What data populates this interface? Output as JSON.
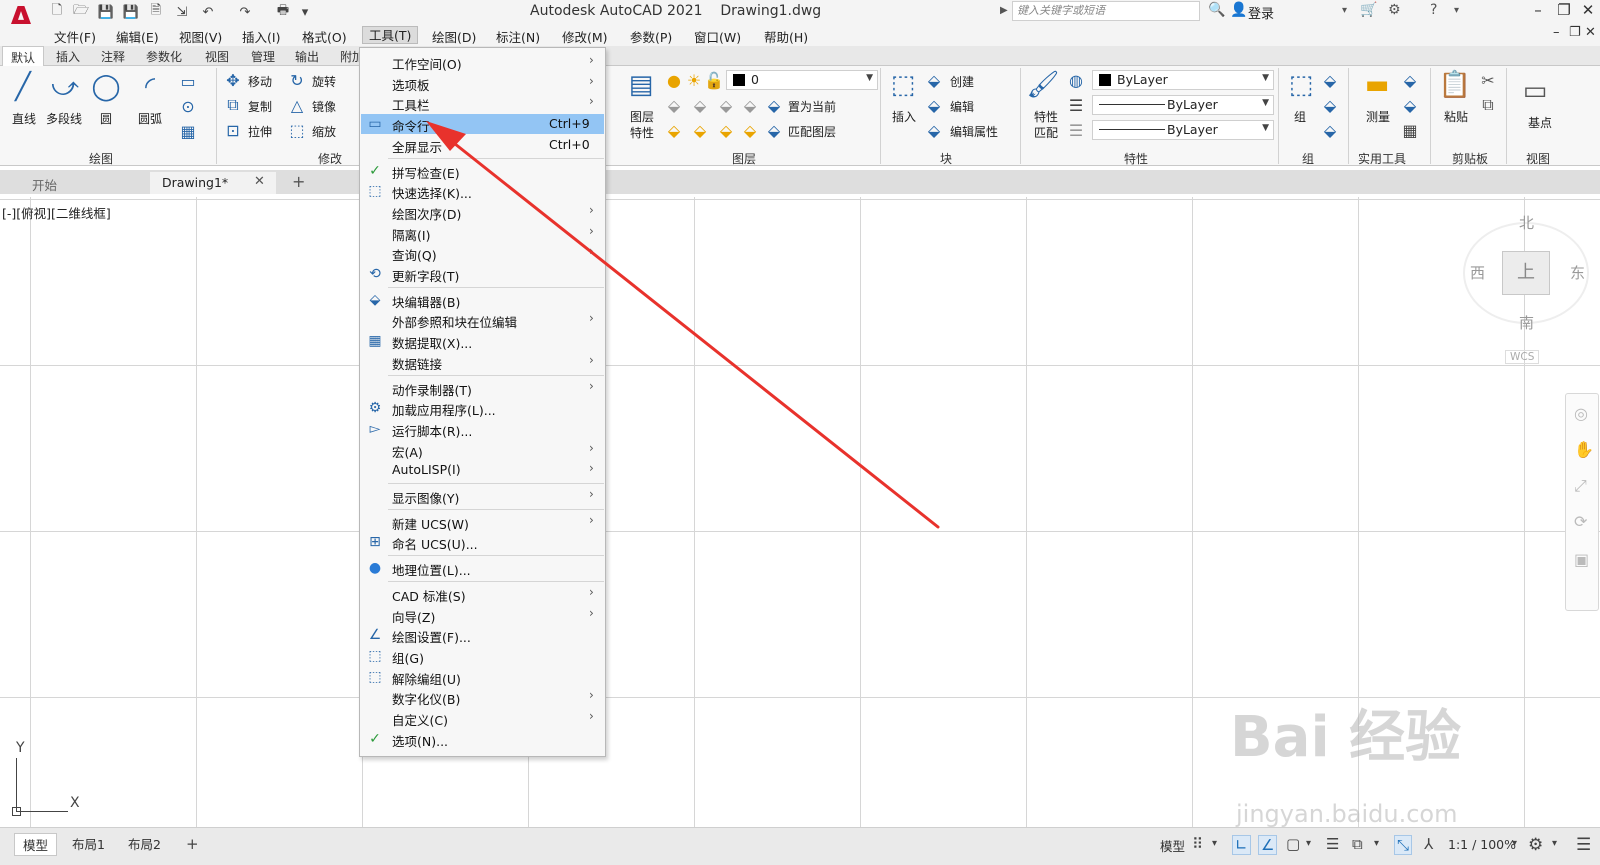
{
  "app": {
    "title": "Autodesk AutoCAD 2021",
    "document": "Drawing1.dwg",
    "search_placeholder": "键入关键字或短语",
    "login": "登录"
  },
  "menubar": [
    "文件(F)",
    "编辑(E)",
    "视图(V)",
    "插入(I)",
    "格式(O)",
    "工具(T)",
    "绘图(D)",
    "标注(N)",
    "修改(M)",
    "参数(P)",
    "窗口(W)",
    "帮助(H)"
  ],
  "ribbon_tabs": [
    "默认",
    "插入",
    "注释",
    "参数化",
    "视图",
    "管理",
    "输出",
    "附加"
  ],
  "ribbon": {
    "draw": {
      "line": "直线",
      "polyline": "多段线",
      "circle": "圆",
      "arc": "圆弧",
      "title": "绘图"
    },
    "modify": {
      "move": "移动",
      "rotate": "旋转",
      "copy": "复制",
      "mirror": "镜像",
      "stretch": "拉伸",
      "scale": "缩放",
      "title": "修改"
    },
    "layers": {
      "properties_line1": "图层",
      "properties_line2": "特性",
      "current_layer": "0",
      "set_current": "置为当前",
      "match_layer": "匹配图层",
      "title": "图层"
    },
    "block": {
      "insert": "插入",
      "create": "创建",
      "edit": "编辑",
      "edit_attributes": "编辑属性",
      "title": "块"
    },
    "properties": {
      "match_line1": "特性",
      "match_line2": "匹配",
      "color": "ByLayer",
      "linetype": "ByLayer",
      "lineweight": "ByLayer",
      "title": "特性"
    },
    "groups": {
      "group": "组",
      "title": "组"
    },
    "utilities": {
      "measure": "测量",
      "title": "实用工具"
    },
    "clipboard": {
      "paste": "粘贴",
      "title": "剪贴板"
    },
    "view": {
      "base": "基点",
      "title": "视图"
    }
  },
  "doc_tabs": {
    "start": "开始",
    "drawing": "Drawing1*"
  },
  "viewport_label": "[-][俯视][二维线框]",
  "viewcube": {
    "north": "北",
    "south": "南",
    "east": "东",
    "west": "西",
    "top": "上",
    "wcs": "WCS"
  },
  "ucs": {
    "x": "X",
    "y": "Y"
  },
  "status": {
    "tabs": [
      "模型",
      "布局1",
      "布局2"
    ],
    "model": "模型",
    "scale": "1:1 / 100%"
  },
  "watermark": {
    "brand": "Bai  经验",
    "url": "jingyan.baidu.com"
  },
  "tools_menu": [
    {
      "label": "工作空间(O)",
      "sub": true,
      "icon": ""
    },
    {
      "label": "选项板",
      "sub": true,
      "icon": ""
    },
    {
      "label": "工具栏",
      "sub": true,
      "icon": ""
    },
    {
      "label": "命令行",
      "shortcut": "Ctrl+9",
      "icon": "command-line-icon",
      "highlight": true
    },
    {
      "label": "全屏显示",
      "shortcut": "Ctrl+0",
      "icon": ""
    },
    {
      "sep": true
    },
    {
      "label": "拼写检查(E)",
      "icon": "spellcheck-icon"
    },
    {
      "label": "快速选择(K)...",
      "icon": "quick-select-icon"
    },
    {
      "label": "绘图次序(D)",
      "sub": true,
      "icon": ""
    },
    {
      "label": "隔离(I)",
      "sub": true,
      "icon": ""
    },
    {
      "label": "查询(Q)",
      "sub": true,
      "icon": ""
    },
    {
      "label": "更新字段(T)",
      "icon": "update-fields-icon"
    },
    {
      "sep": true
    },
    {
      "label": "块编辑器(B)",
      "icon": "block-editor-icon"
    },
    {
      "label": "外部参照和块在位编辑",
      "sub": true,
      "icon": ""
    },
    {
      "label": "数据提取(X)...",
      "icon": "data-extraction-icon"
    },
    {
      "label": "数据链接",
      "sub": true,
      "icon": ""
    },
    {
      "sep": true
    },
    {
      "label": "动作录制器(T)",
      "sub": true,
      "icon": ""
    },
    {
      "label": "加载应用程序(L)...",
      "icon": "load-app-icon"
    },
    {
      "label": "运行脚本(R)...",
      "icon": "run-script-icon"
    },
    {
      "label": "宏(A)",
      "sub": true,
      "icon": ""
    },
    {
      "label": "AutoLISP(I)",
      "sub": true,
      "icon": ""
    },
    {
      "sep": true
    },
    {
      "label": "显示图像(Y)",
      "sub": true,
      "icon": ""
    },
    {
      "sep": true
    },
    {
      "label": "新建 UCS(W)",
      "sub": true,
      "icon": ""
    },
    {
      "label": "命名 UCS(U)...",
      "icon": "named-ucs-icon"
    },
    {
      "sep": true
    },
    {
      "label": "地理位置(L)...",
      "icon": "globe-icon"
    },
    {
      "sep": true
    },
    {
      "label": "CAD 标准(S)",
      "sub": true,
      "icon": ""
    },
    {
      "label": "向导(Z)",
      "sub": true,
      "icon": ""
    },
    {
      "label": "绘图设置(F)...",
      "icon": "drafting-settings-icon"
    },
    {
      "label": "组(G)",
      "icon": "group-icon"
    },
    {
      "label": "解除编组(U)",
      "icon": "ungroup-icon"
    },
    {
      "label": "数字化仪(B)",
      "sub": true,
      "icon": ""
    },
    {
      "label": "自定义(C)",
      "sub": true,
      "icon": ""
    },
    {
      "label": "选项(N)...",
      "icon": "options-check-icon"
    }
  ],
  "colors": {
    "highlight": "#93c5f4",
    "arrow": "#e8322c",
    "accent": "#2766a8"
  }
}
